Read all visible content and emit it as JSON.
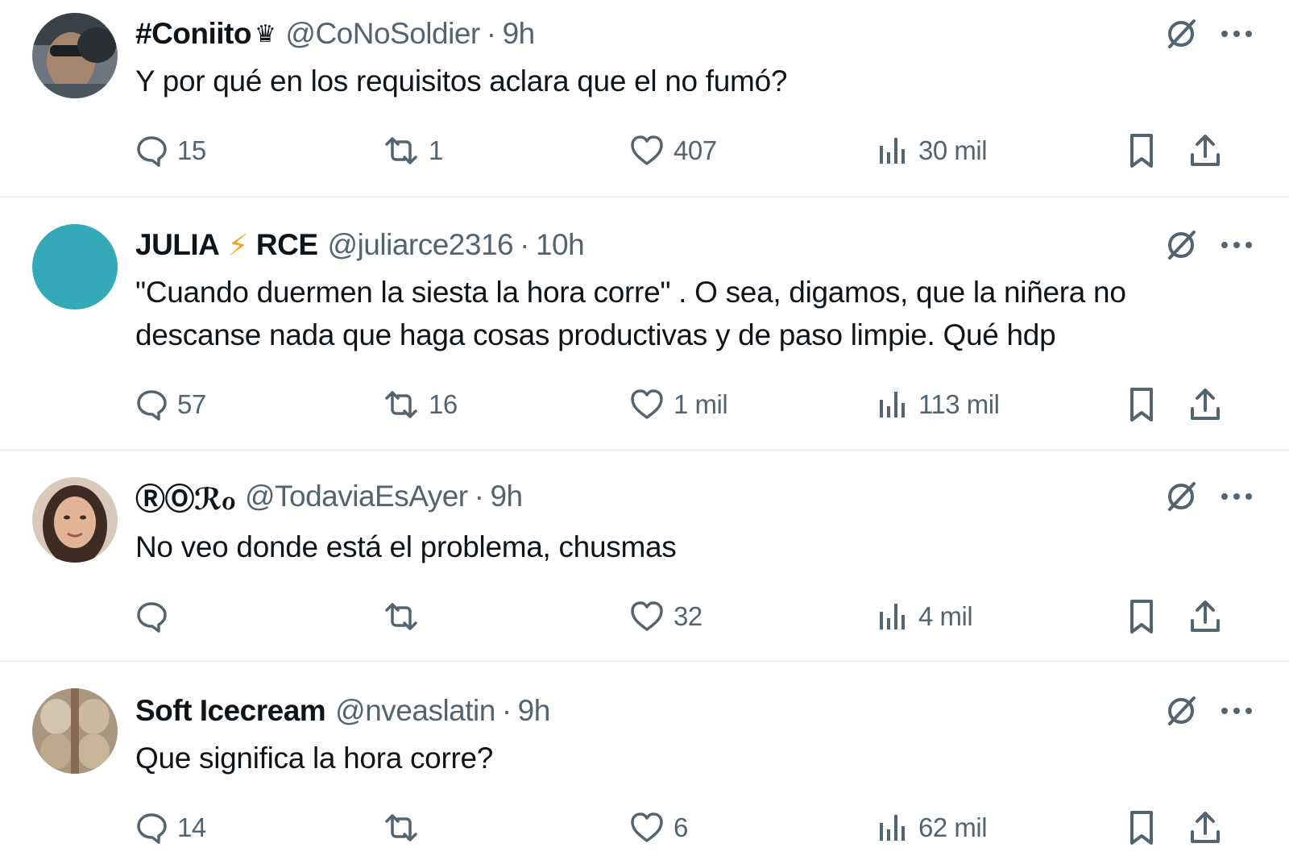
{
  "colors": {
    "text": "#0f1419",
    "muted": "#536471",
    "divider": "#eff3f4",
    "bolt": "#f5a623"
  },
  "icons": {
    "reply": "speech-bubble-icon",
    "retweet": "retweet-icon",
    "like": "heart-icon",
    "views": "bar-chart-icon",
    "bookmark": "bookmark-icon",
    "share": "share-icon",
    "grok": "grok-icon",
    "more": "more-dots-icon"
  },
  "tweets": [
    {
      "name": "#Coniito",
      "name_suffix": "♛",
      "handle": "@CoNoSoldier",
      "sep": "·",
      "time": "9h",
      "text": "Y por qué en los requisitos aclara que el no fumó?",
      "replies": "15",
      "retweets": "1",
      "likes": "407",
      "views": "30 mil"
    },
    {
      "name": "JULIA",
      "name_mid": "⚡",
      "name_end": "RCE",
      "handle": "@juliarce2316",
      "sep": "·",
      "time": "10h",
      "text": "\"Cuando duermen la siesta la hora corre\" . O sea, digamos, que la niñera no descanse nada que haga cosas productivas y de paso limpie. Qué hdp",
      "replies": "57",
      "retweets": "16",
      "likes": "1 mil",
      "views": "113 mil"
    },
    {
      "name": "ⓇⓄℛℴ",
      "handle": "@TodaviaEsAyer",
      "sep": "·",
      "time": "9h",
      "text": "No veo donde está el problema, chusmas",
      "replies": "",
      "retweets": "",
      "likes": "32",
      "views": "4 mil"
    },
    {
      "name": "Soft Icecream",
      "handle": "@nveaslatin",
      "sep": "·",
      "time": "9h",
      "text": "Que significa la hora corre?",
      "replies": "14",
      "retweets": "",
      "likes": "6",
      "views": "62 mil"
    }
  ]
}
